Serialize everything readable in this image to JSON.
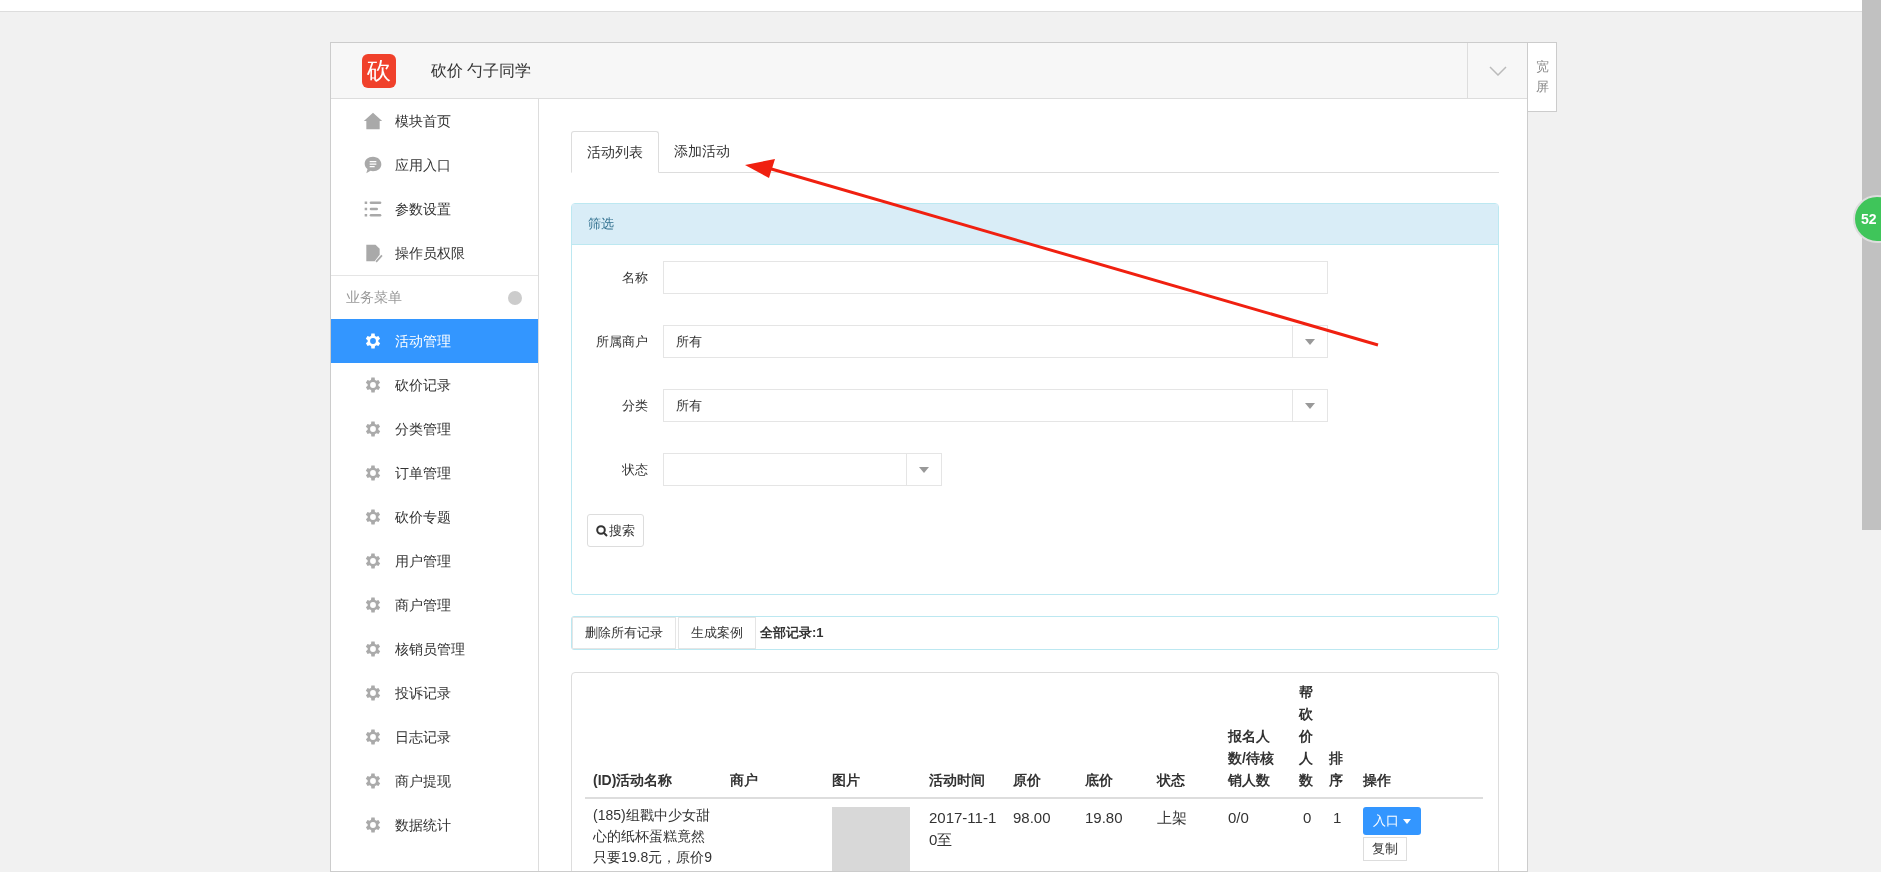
{
  "header": {
    "logo_char": "砍",
    "title": "砍价 勺子同学",
    "wide_toggle": "宽屏"
  },
  "sidebar": {
    "top_items": [
      {
        "label": "模块首页",
        "selected": false
      },
      {
        "label": "应用入口",
        "selected": false
      },
      {
        "label": "参数设置",
        "selected": false
      },
      {
        "label": "操作员权限",
        "selected": false
      }
    ],
    "section": {
      "title": "业务菜单",
      "expanded": true
    },
    "items": [
      {
        "label": "活动管理",
        "selected": true
      },
      {
        "label": "砍价记录",
        "selected": false
      },
      {
        "label": "分类管理",
        "selected": false
      },
      {
        "label": "订单管理",
        "selected": false
      },
      {
        "label": "砍价专题",
        "selected": false
      },
      {
        "label": "用户管理",
        "selected": false
      },
      {
        "label": "商户管理",
        "selected": false
      },
      {
        "label": "核销员管理",
        "selected": false
      },
      {
        "label": "投诉记录",
        "selected": false
      },
      {
        "label": "日志记录",
        "selected": false
      },
      {
        "label": "商户提现",
        "selected": false
      },
      {
        "label": "数据统计",
        "selected": false
      }
    ]
  },
  "tabs": [
    {
      "label": "活动列表",
      "selected": true
    },
    {
      "label": "添加活动",
      "selected": false
    }
  ],
  "filter": {
    "title": "筛选",
    "fields": [
      {
        "kind": "input",
        "label": "名称"
      },
      {
        "kind": "select",
        "label": "所属商户",
        "value": "所有"
      },
      {
        "kind": "select",
        "label": "分类",
        "value": "所有"
      },
      {
        "kind": "short-select",
        "label": "状态"
      }
    ],
    "search_button": "搜索"
  },
  "toolbar": {
    "buttons": [
      "删除所有记录",
      "生成案例"
    ],
    "total": "全部记录:1"
  },
  "table": {
    "columns": [
      {
        "label": "(ID)活动名称"
      },
      {
        "label": "商户"
      },
      {
        "label": "图片"
      },
      {
        "label": "活动时间"
      },
      {
        "label": "原价"
      },
      {
        "label": "底价"
      },
      {
        "label": "状态"
      },
      {
        "label": "报名人数/待核销人数"
      },
      {
        "label": "帮砍价人数"
      },
      {
        "label": "排序"
      },
      {
        "label": "操作"
      }
    ],
    "rows": [
      {
        "name": "(185)组戳中少女甜心的纸杯蛋糕竟然只要19.8元，原价9",
        "merchant": "",
        "time": "2017-11-10至",
        "price": "98.00",
        "floor": "19.80",
        "status": "上架",
        "counts": "0/0",
        "helpers": "0",
        "order": "1",
        "actions": [
          "入口",
          "复制"
        ]
      }
    ]
  },
  "badge": "52"
}
